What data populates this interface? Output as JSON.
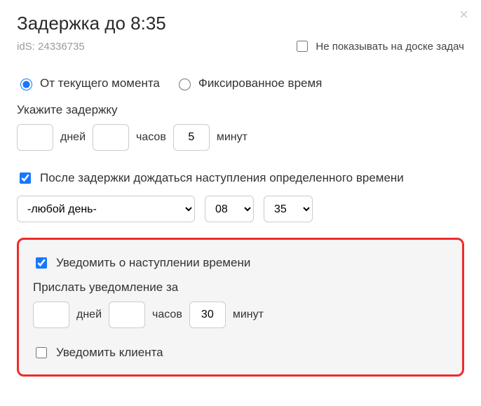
{
  "title": "Задержка до 8:35",
  "ids_label": "idS: 24336735",
  "hide_on_board": {
    "label": "Не показывать на доске задач",
    "checked": false
  },
  "mode": {
    "current": {
      "label": "От текущего момента",
      "selected": true
    },
    "fixed": {
      "label": "Фиксированное время",
      "selected": false
    }
  },
  "delay": {
    "heading": "Укажите задержку",
    "days": {
      "value": "",
      "unit": "дней"
    },
    "hours": {
      "value": "",
      "unit": "часов"
    },
    "minutes": {
      "value": "5",
      "unit": "минут"
    }
  },
  "wait_specific": {
    "label": "После задержки дождаться наступления определенного времени",
    "checked": true,
    "day_value": "-любой день-",
    "hour_value": "08",
    "minute_value": "35"
  },
  "notify": {
    "label": "Уведомить о наступлении времени",
    "checked": true,
    "lead_heading": "Прислать уведомление за",
    "days": {
      "value": "",
      "unit": "дней"
    },
    "hours": {
      "value": "",
      "unit": "часов"
    },
    "minutes": {
      "value": "30",
      "unit": "минут"
    }
  },
  "notify_client": {
    "label": "Уведомить клиента",
    "checked": false
  }
}
